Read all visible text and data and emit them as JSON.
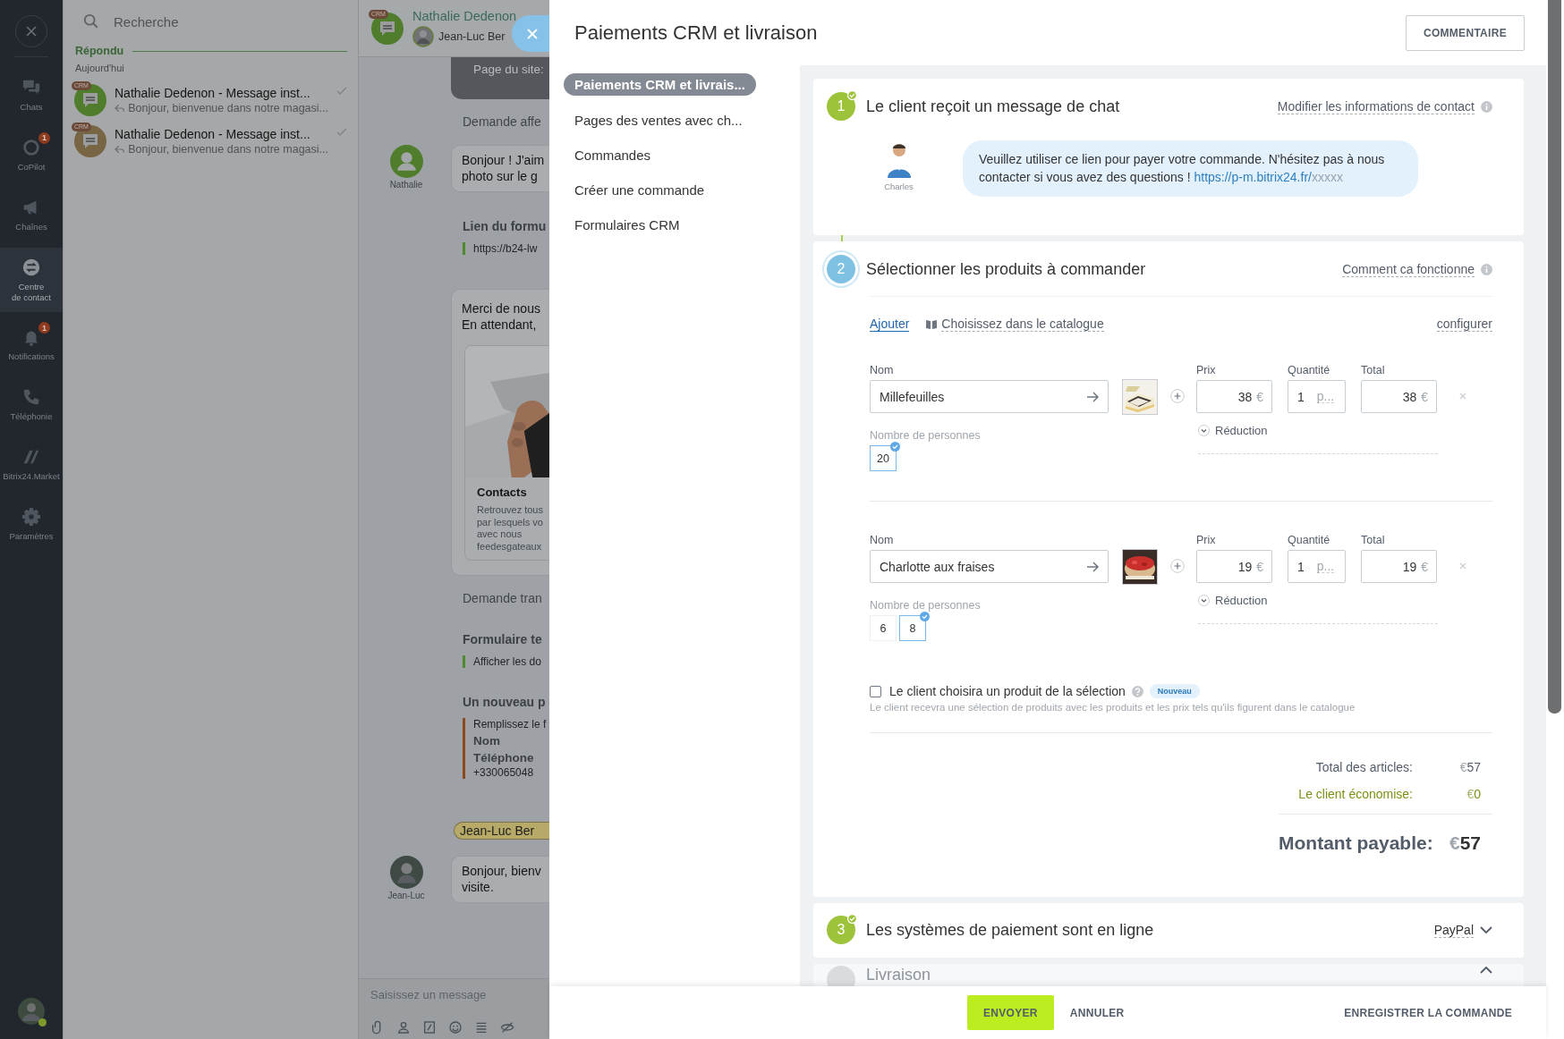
{
  "nav": {
    "items": [
      {
        "label": "Chats",
        "selected": false
      },
      {
        "label": "CoPilot",
        "badge": "1",
        "selected": false
      },
      {
        "label": "Chaînes",
        "selected": false
      },
      {
        "label": "Centre\nde contact",
        "selected": true
      },
      {
        "label": "Notifications",
        "badge": "1",
        "selected": false
      },
      {
        "label": "Téléphonie",
        "selected": false
      },
      {
        "label": "Bitrix24.Market",
        "selected": false
      },
      {
        "label": "Paramètres",
        "selected": false
      }
    ]
  },
  "chat_list": {
    "search_placeholder": "Recherche",
    "section": "Répondu",
    "date": "Aujourd'hui",
    "items": [
      {
        "tag": "CRM",
        "title": "Nathalie Dedenon - Message inst...",
        "preview": "Bonjour, bienvenue dans notre magasi...",
        "color": "#4f7d2c"
      },
      {
        "tag": "CRM",
        "title": "Nathalie Dedenon - Message inst...",
        "preview": "Bonjour, bienvenue dans notre magasi...",
        "color": "#786544"
      }
    ]
  },
  "chat": {
    "header": {
      "tag": "CRM",
      "title": "Nathalie Dedenon",
      "subtitle": "Jean-Luc Ber"
    },
    "messages": [
      {
        "kind": "banner",
        "text": "Page du site:"
      },
      {
        "kind": "system",
        "text": "Demande affe"
      },
      {
        "kind": "incoming",
        "author": "Nathalie",
        "lines": [
          "Bonjour ! J'aim",
          "photo sur le g"
        ]
      },
      {
        "kind": "form",
        "title": "Lien du formu",
        "color": "#4f8a2a",
        "lines": [
          {
            "text": "https://b24-lw",
            "bold": false
          }
        ]
      },
      {
        "kind": "card",
        "lines": [
          "Merci de nous",
          "En attendant,"
        ],
        "card_title": "Contacts",
        "card_lines": [
          "Retrouvez tous",
          "par lesquels vo",
          "avec nous",
          "feedesgateaux"
        ]
      },
      {
        "kind": "system",
        "text": "Demande tran"
      },
      {
        "kind": "form",
        "title": "Formulaire te",
        "color": "#4f8a2a",
        "lines": [
          {
            "text": "Afficher les do",
            "bold": false
          }
        ]
      },
      {
        "kind": "form",
        "title": "Un nouveau p",
        "color": "#8a4a1e",
        "lines": [
          {
            "text": "Remplissez le f",
            "bold": false
          },
          {
            "text": "Nom",
            "bold": true
          },
          {
            "text": "Téléphone",
            "bold": true
          },
          {
            "text": "+330065048",
            "bold": false
          }
        ]
      },
      {
        "kind": "mention",
        "text": "Jean-Luc Ber"
      },
      {
        "kind": "outgoing",
        "author": "Jean-Luc",
        "lines": [
          "Bonjour, bienv",
          "visite."
        ]
      }
    ],
    "input_placeholder": "Saisissez un message"
  },
  "panel": {
    "title": "Paiements CRM et livraison",
    "comment_button": "COMMENTAIRE",
    "menu": [
      {
        "label": "Paiements CRM et livrais...",
        "selected": true
      },
      {
        "label": "Pages des ventes avec ch...",
        "selected": false
      },
      {
        "label": "Commandes",
        "selected": false
      },
      {
        "label": "Créer une commande",
        "selected": false
      },
      {
        "label": "Formulaires CRM",
        "selected": false
      }
    ],
    "steps": [
      {
        "kind": "message",
        "number": "1",
        "done": true,
        "current": false,
        "title": "Le client reçoit un message de chat",
        "link": "Modifier les informations de contact",
        "agent": "Charles",
        "message": "Veuillez utiliser ce lien pour payer votre commande. N'hésitez pas à nous contacter si vous avez des questions ! ",
        "message_link": "https://p-m.bitrix24.fr/",
        "message_link_tail": "xxxxx"
      },
      {
        "kind": "products",
        "number": "2",
        "done": false,
        "current": true,
        "title": "Sélectionner les produits à commander",
        "link": "Comment ca fonctionne",
        "toolbar": {
          "add": "Ajouter",
          "catalog": "Choisissez dans le catalogue",
          "configure": "configurer"
        },
        "products": [
          {
            "name_label": "Nom",
            "name": "Millefeuilles",
            "price_label": "Prix",
            "price": "38",
            "price_currency": "€",
            "qty_label": "Quantité",
            "qty": "1",
            "unit": "p...",
            "total_label": "Total",
            "total": "38",
            "total_currency": "€",
            "discount": "Réduction",
            "option_label": "Nombre de personnes",
            "options": [
              {
                "label": "20",
                "selected": true
              }
            ]
          },
          {
            "name_label": "Nom",
            "name": "Charlotte aux fraises",
            "price_label": "Prix",
            "price": "19",
            "price_currency": "€",
            "qty_label": "Quantité",
            "qty": "1",
            "unit": "p...",
            "total_label": "Total",
            "total": "19",
            "total_currency": "€",
            "discount": "Réduction",
            "option_label": "Nombre de personnes",
            "options": [
              {
                "label": "6",
                "selected": false
              },
              {
                "label": "8",
                "selected": true
              }
            ]
          }
        ],
        "selection": {
          "checked": false,
          "label": "Le client choisira un produit de la sélection",
          "badge": "Nouveau",
          "hint": "Le client recevra une sélection de produits avec les produits et les prix tels qu'ils figurent dans le catalogue"
        },
        "totals": [
          {
            "kind": "normal",
            "label": "Total des articles:",
            "currency": "€",
            "value": "57"
          },
          {
            "kind": "savings",
            "label": "Le client économise:",
            "currency": "€",
            "value": "0"
          }
        ],
        "payable": {
          "label": "Montant payable:",
          "currency": "€",
          "value": "57"
        }
      },
      {
        "kind": "payment",
        "number": "3",
        "done": true,
        "current": false,
        "title": "Les systèmes de paiement sont en ligne",
        "value": "PayPal",
        "expanded": false
      },
      {
        "kind": "collapsed",
        "done": false,
        "current": false,
        "title": "Livraison",
        "expanded": true
      }
    ],
    "footer": [
      {
        "kind": "primary",
        "label": "ENVOYER"
      },
      {
        "kind": "plain",
        "label": "ANNULER"
      },
      {
        "kind": "right",
        "label": "ENREGISTRER LA COMMANDE"
      }
    ]
  }
}
